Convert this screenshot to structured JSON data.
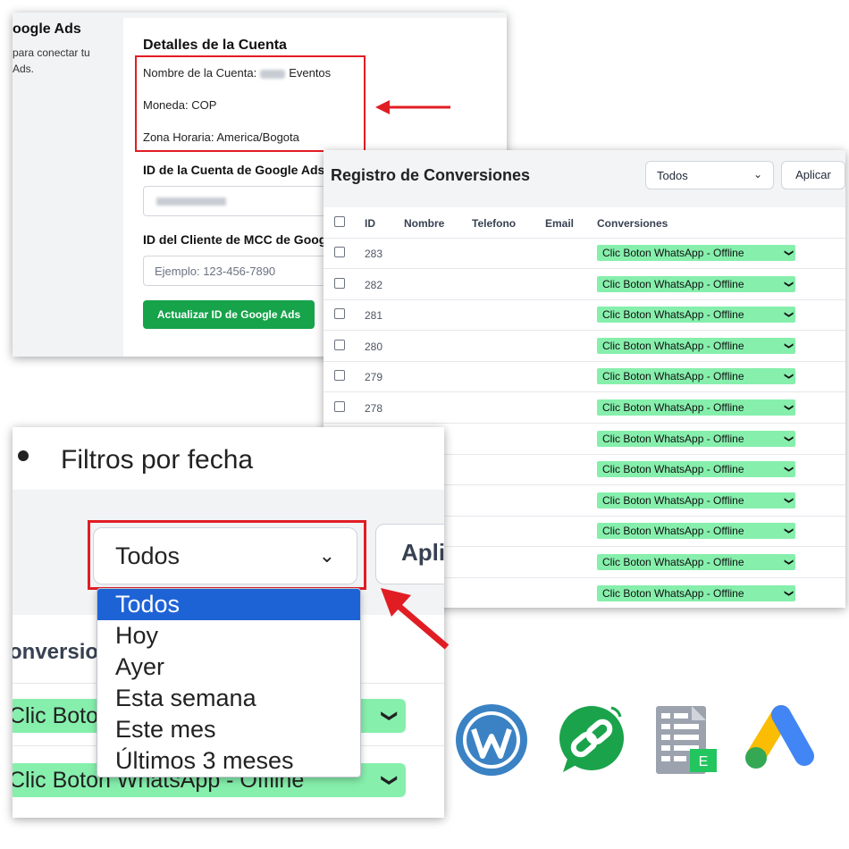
{
  "account": {
    "sidebar_title": "oogle Ads",
    "sidebar_desc": "para conectar tu Ads.",
    "section_title": "Detalles de la Cuenta",
    "name_label": "Nombre de la Cuenta:",
    "name_value": "Eventos",
    "currency": "Moneda: COP",
    "timezone": "Zona Horaria: America/Bogota",
    "account_id_label": "ID de la Cuenta de Google Ads",
    "mcc_label": "ID del Cliente de MCC de Goog",
    "mcc_placeholder": "Ejemplo: 123-456-7890",
    "update_button": "Actualizar ID de Google Ads"
  },
  "conversions": {
    "title": "Registro de Conversiones",
    "filter_value": "Todos",
    "apply_label": "Aplicar",
    "columns": [
      "ID",
      "Nombre",
      "Telefono",
      "Email",
      "Conversiones"
    ],
    "ids": [
      "283",
      "282",
      "281",
      "280",
      "279",
      "278"
    ],
    "conversion_value": "Clic Boton WhatsApp - Offline",
    "row_count": 12
  },
  "date_filter": {
    "heading": "Filtros por fecha",
    "selected": "Todos",
    "apply_partial": "Apli",
    "options": [
      "Todos",
      "Hoy",
      "Ayer",
      "Esta semana",
      "Este mes",
      "Últimos 3 meses"
    ],
    "conversions_partial": "onversio",
    "conv_row_1": "Clic Boton",
    "conv_row_2": "Clic Boton WhatsApp - Offline"
  },
  "colors": {
    "accent_green": "#16a34a",
    "conversion_green": "#86efac",
    "highlight_red": "#e11d24",
    "selected_blue": "#1e63d6"
  },
  "icons": [
    "wordpress-icon",
    "link-chat-icon",
    "spreadsheet-icon",
    "google-ads-icon"
  ]
}
